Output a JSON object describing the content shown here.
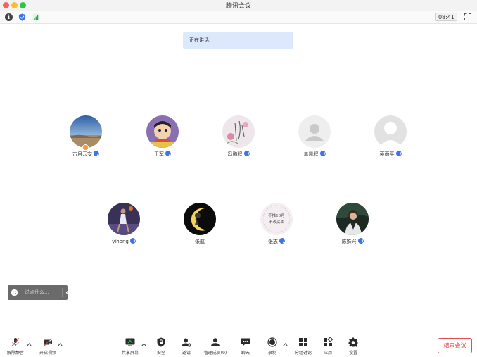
{
  "window": {
    "title": "腾讯会议"
  },
  "statusbar": {
    "clock": "08:41"
  },
  "speaking": {
    "label": "正在讲话:"
  },
  "participants": [
    {
      "name": "古月云安",
      "avatar": "desert-sky-photo",
      "host": true
    },
    {
      "name": "王军",
      "avatar": "cartoon-character"
    },
    {
      "name": "冯鹏程",
      "avatar": "flower-calligraphy"
    },
    {
      "name": "盖凯程",
      "avatar": "default-user"
    },
    {
      "name": "蒋雨平",
      "avatar": "default-user"
    },
    {
      "name": "yihong",
      "avatar": "basketball-photo"
    },
    {
      "name": "张航",
      "avatar": "moon-night"
    },
    {
      "name": "张志",
      "avatar": "text-card",
      "avatar_text": [
        "不推10月",
        "不改买卖"
      ]
    },
    {
      "name": "陈姝兴",
      "avatar": "person-portrait"
    }
  ],
  "chat": {
    "placeholder": "说点什么..."
  },
  "toolbar": {
    "mute": "解除静音",
    "video": "开启视频",
    "share": "共享屏幕",
    "security": "安全",
    "invite": "邀请",
    "members": "管理成员(9)",
    "chat": "聊天",
    "record": "录制",
    "breakout": "分组讨论",
    "apps": "应用",
    "settings": "设置"
  },
  "end_meeting": "结束会议",
  "colors": {
    "accent": "#3f74e9",
    "danger": "#e0393e",
    "banner": "#dce8fb"
  }
}
